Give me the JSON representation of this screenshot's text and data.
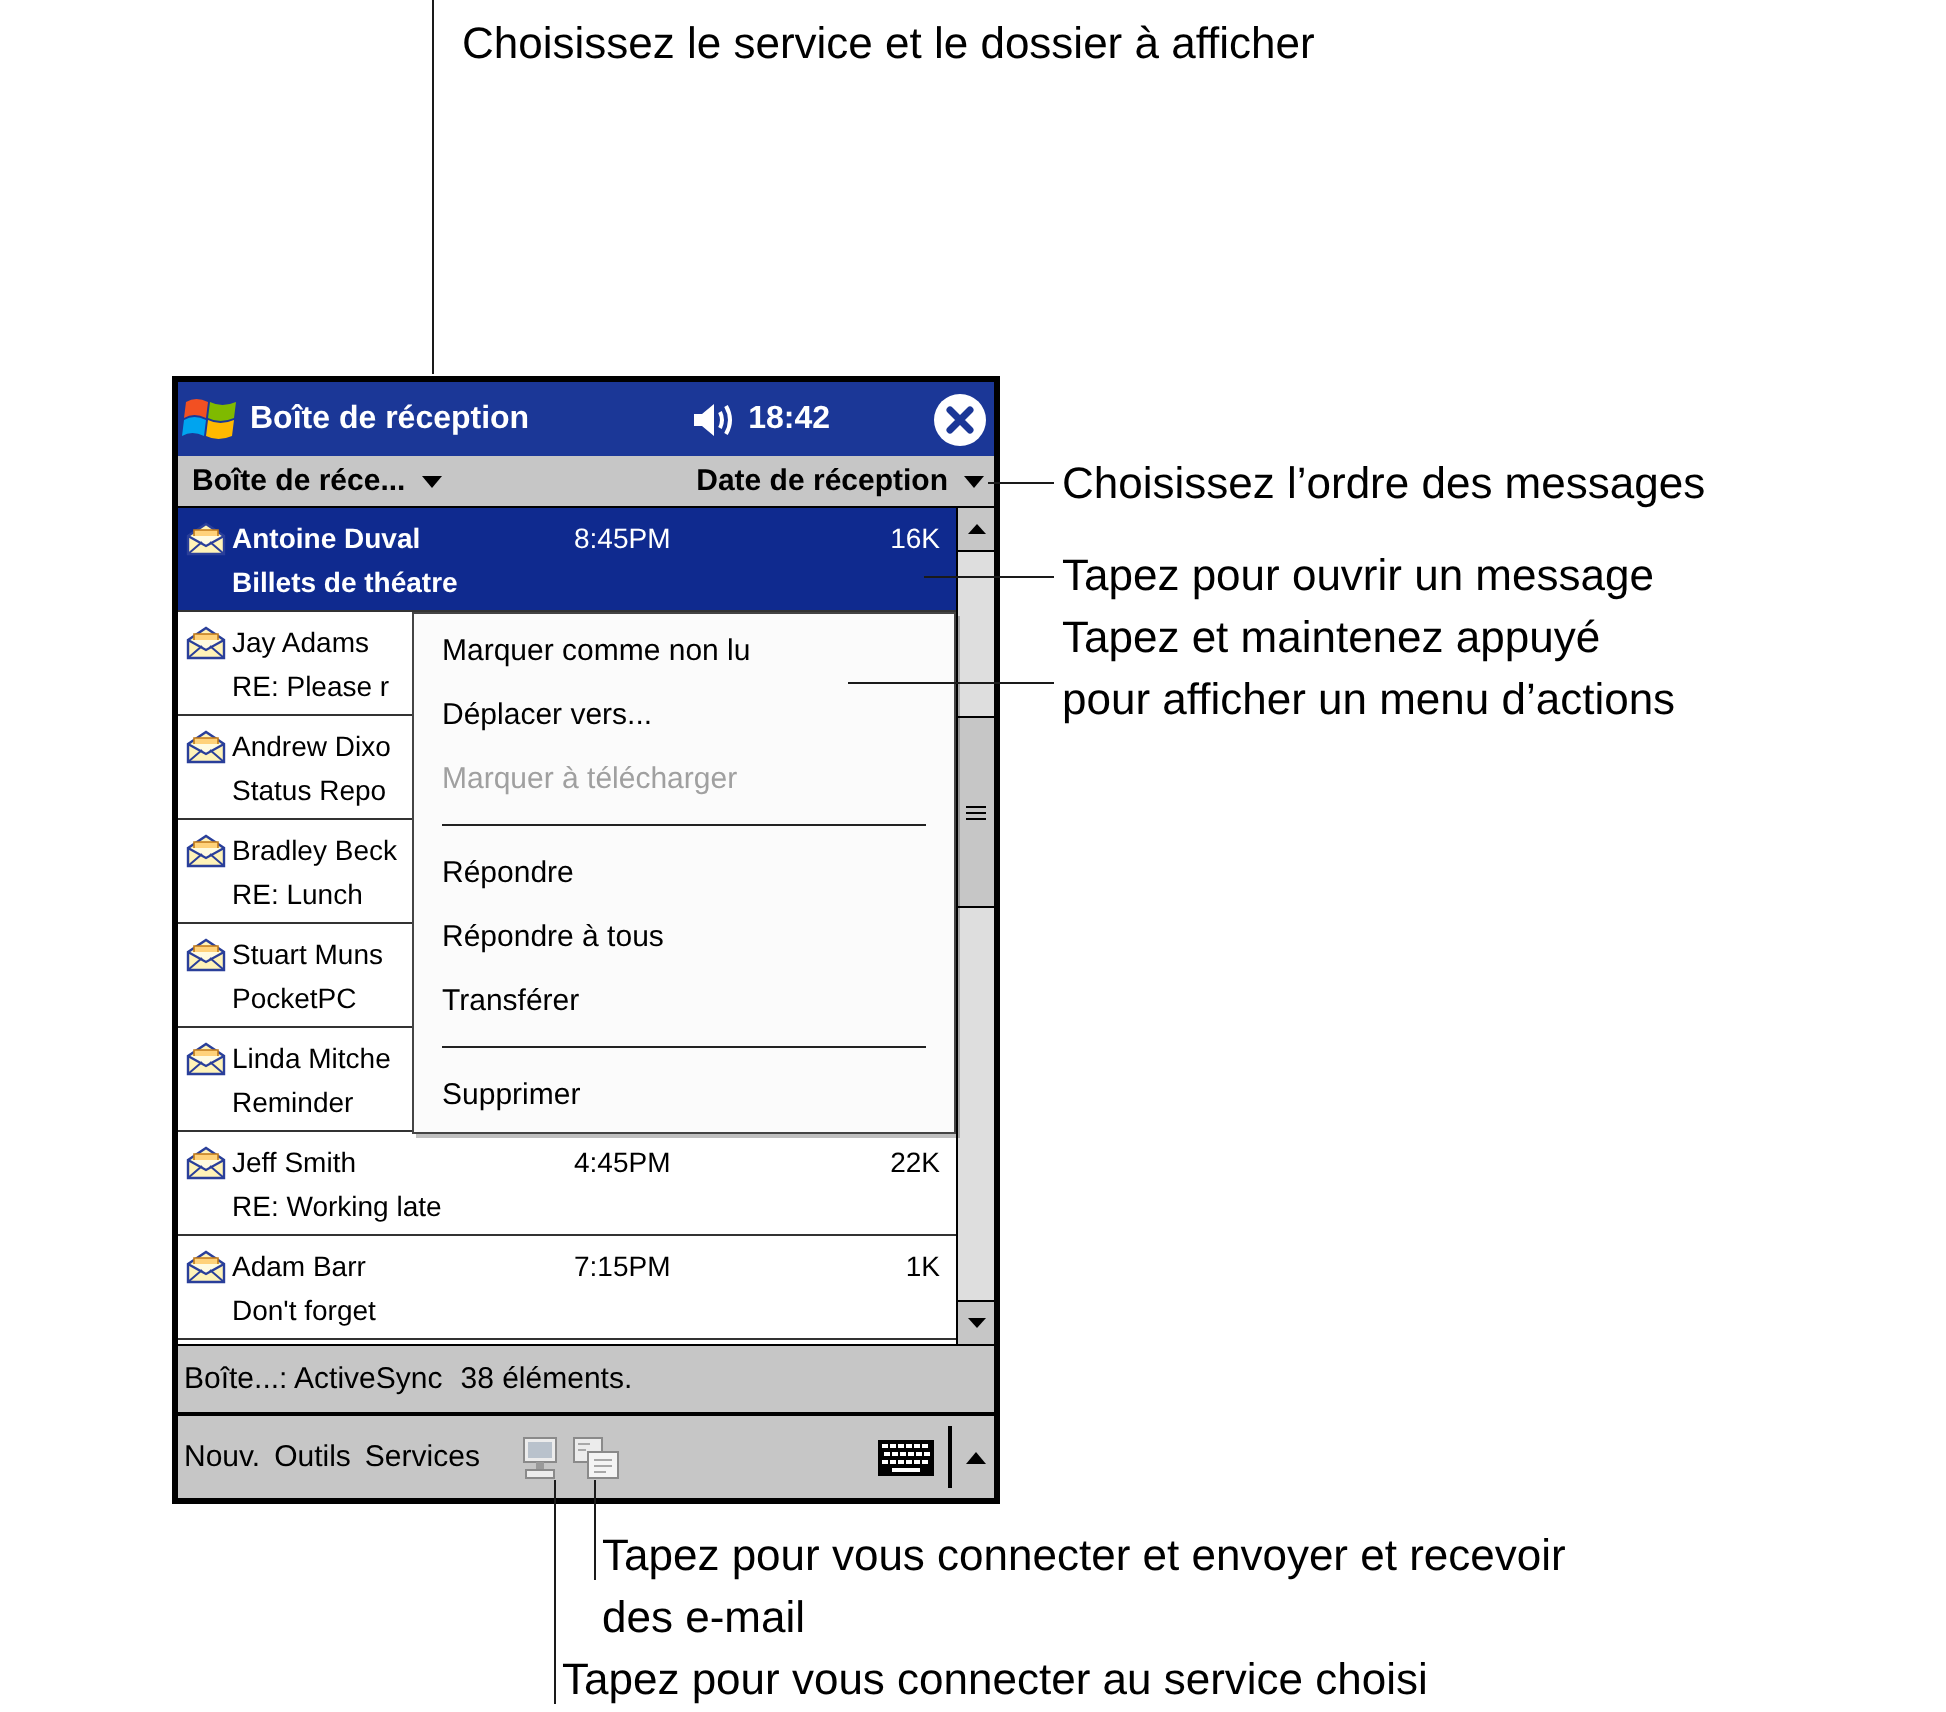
{
  "callouts": [
    {
      "lines": [
        "Choisissez le service et le dossier à afficher"
      ]
    },
    {
      "lines": [
        "Choisissez l’ordre des messages"
      ]
    },
    {
      "lines": [
        "Tapez pour ouvrir un message"
      ]
    },
    {
      "lines": [
        "Tapez et maintenez appuyé",
        "pour afficher un menu d’actions"
      ]
    },
    {
      "lines": [
        "Tapez pour vous connecter et envoyer et recevoir",
        "des e-mail"
      ]
    },
    {
      "lines": [
        "Tapez pour vous connecter au service choisi"
      ]
    }
  ],
  "window": {
    "title": "Boîte de réception",
    "clock": "18:42"
  },
  "header": {
    "folder": "Boîte de réce...",
    "sort": "Date de réception"
  },
  "messages": [
    {
      "sender": "Antoine Duval",
      "time": "8:45PM",
      "size": "16K",
      "subject": "Billets de théatre",
      "unread": true,
      "selected": true
    },
    {
      "sender": "Jay Adams",
      "subject": "RE: Please r",
      "unread": false,
      "selected": false
    },
    {
      "sender": "Andrew Dixo",
      "subject": "Status Repo",
      "unread": false,
      "selected": false
    },
    {
      "sender": "Bradley Beck",
      "subject": "RE: Lunch",
      "unread": false,
      "selected": false
    },
    {
      "sender": "Stuart Muns",
      "subject": "PocketPC",
      "unread": false,
      "selected": false
    },
    {
      "sender": "Linda Mitche",
      "subject": "Reminder",
      "unread": false,
      "selected": false
    },
    {
      "sender": "Jeff Smith",
      "time": "4:45PM",
      "size": "22K",
      "subject": "RE: Working late",
      "unread": false,
      "selected": false
    },
    {
      "sender": "Adam Barr",
      "time": "7:15PM",
      "size": "1K",
      "subject": "Don't forget",
      "unread": false,
      "selected": false
    }
  ],
  "context_menu": {
    "groups": [
      [
        {
          "label": "Marquer comme non lu",
          "disabled": false
        },
        {
          "label": "Déplacer vers...",
          "disabled": false
        },
        {
          "label": "Marquer à télécharger",
          "disabled": true
        }
      ],
      [
        {
          "label": "Répondre",
          "disabled": false
        },
        {
          "label": "Répondre à tous",
          "disabled": false
        },
        {
          "label": "Transférer",
          "disabled": false
        }
      ],
      [
        {
          "label": "Supprimer",
          "disabled": false
        }
      ]
    ]
  },
  "status_bar": {
    "account": "Boîte...: ActiveSync",
    "count": "38 éléments."
  },
  "menu_bar": {
    "menus": [
      "Nouv.",
      "Outils",
      "Services"
    ]
  }
}
